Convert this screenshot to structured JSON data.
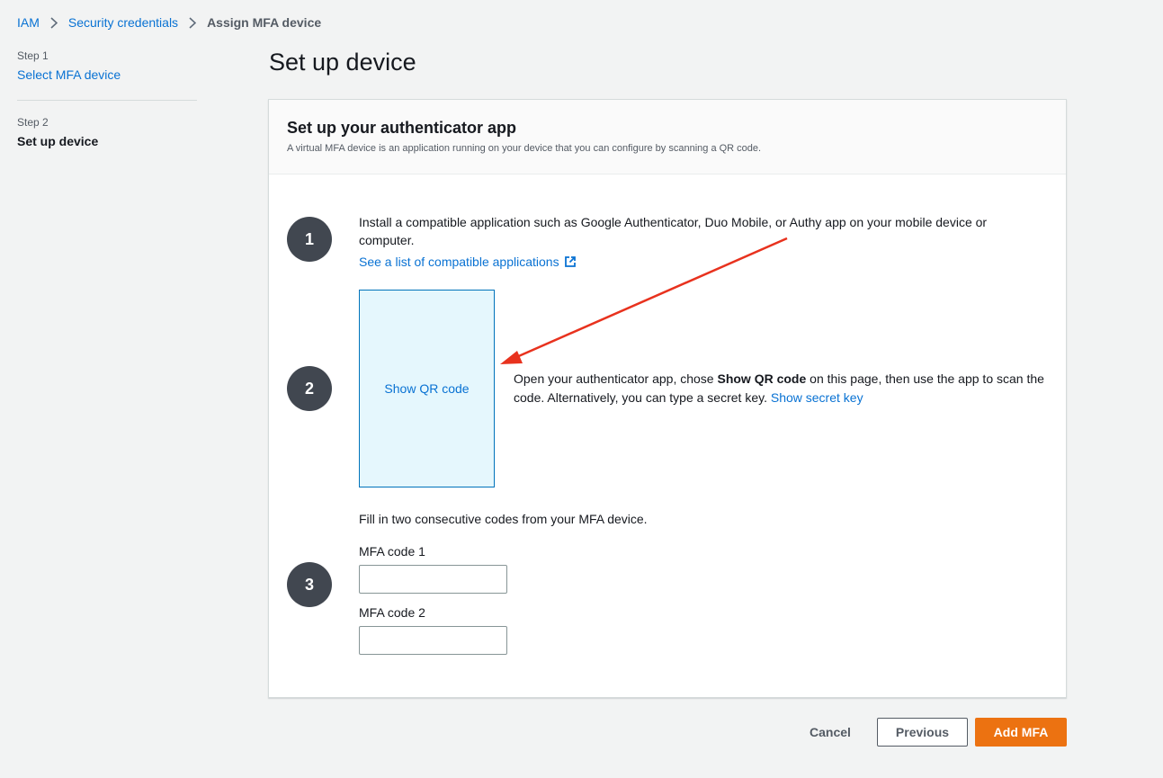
{
  "breadcrumb": {
    "items": [
      "IAM",
      "Security credentials"
    ],
    "current": "Assign MFA device"
  },
  "steps": [
    {
      "label": "Step 1",
      "title": "Select MFA device"
    },
    {
      "label": "Step 2",
      "title": "Set up device"
    }
  ],
  "page_title": "Set up device",
  "panel": {
    "title": "Set up your authenticator app",
    "description": "A virtual MFA device is an application running on your device that you can configure by scanning a QR code."
  },
  "step_one": {
    "number": "1",
    "text": "Install a compatible application such as Google Authenticator, Duo Mobile, or Authy app on your mobile device or computer.",
    "link": "See a list of compatible applications"
  },
  "step_two": {
    "number": "2",
    "qr_button": "Show QR code",
    "text_before": "Open your authenticator app, chose ",
    "text_bold": "Show QR code",
    "text_after": " on this page, then use the app to scan the code. Alternatively, you can type a secret key. ",
    "secret_link": "Show secret key"
  },
  "step_three": {
    "number": "3",
    "text": "Fill in two consecutive codes from your MFA device.",
    "field1_label": "MFA code 1",
    "field1_value": "",
    "field2_label": "MFA code 2",
    "field2_value": ""
  },
  "footer": {
    "cancel": "Cancel",
    "previous": "Previous",
    "submit": "Add MFA"
  },
  "colors": {
    "link": "#0972d3",
    "primary_button": "#ec7211",
    "annotation_arrow": "#e8321e"
  },
  "icons": [
    "chevron-right-icon",
    "external-link-icon"
  ]
}
